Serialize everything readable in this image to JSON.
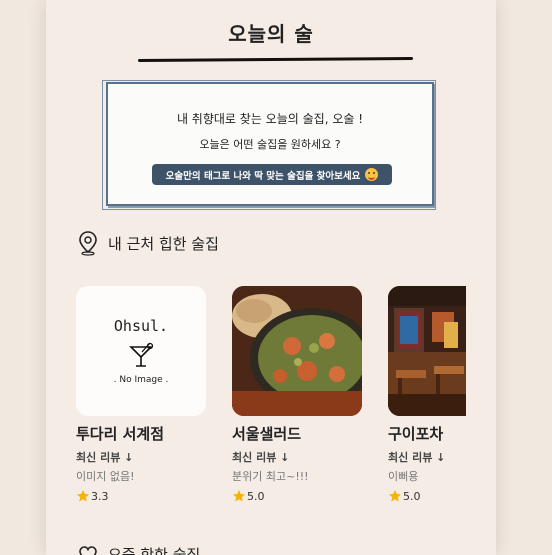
{
  "header": {
    "title": "오늘의 술"
  },
  "intro": {
    "line1": "내 취향대로 찾는 오늘의 술집, 오술 !",
    "line2": "오늘은 어떤 술집을 원하세요 ?",
    "tag_button": "오술만의 태그로 나와 딱 맞는 술집을 찾아보세요"
  },
  "nearby": {
    "heading": "내 근처 힙한 술집",
    "icon": "map-pin-icon",
    "bars": [
      {
        "name": "투다리 서계점",
        "latest_label": "최신 리뷰 ↓",
        "review": "이미지 없음!",
        "rating": "3.3",
        "image": "no-image"
      },
      {
        "name": "서울샐러드",
        "latest_label": "최신 리뷰 ↓",
        "review": "분위기 최고~!!!",
        "rating": "5.0",
        "image": "food-photo"
      },
      {
        "name": "구이포차",
        "latest_label": "최신 리뷰 ↓",
        "review": "이뻐용",
        "rating": "5.0",
        "image": "pub-photo"
      }
    ]
  },
  "placeholder": {
    "brand": "Ohsul.",
    "caption": ". No Image ."
  },
  "next_section": {
    "heading": "요즘 핫한 술집",
    "icon": "heart-icon"
  },
  "colors": {
    "background": "#f1e8df",
    "panel": "#f5ede5",
    "button": "#3f5368",
    "box_border": "#58708a",
    "star": "#f5b400"
  }
}
